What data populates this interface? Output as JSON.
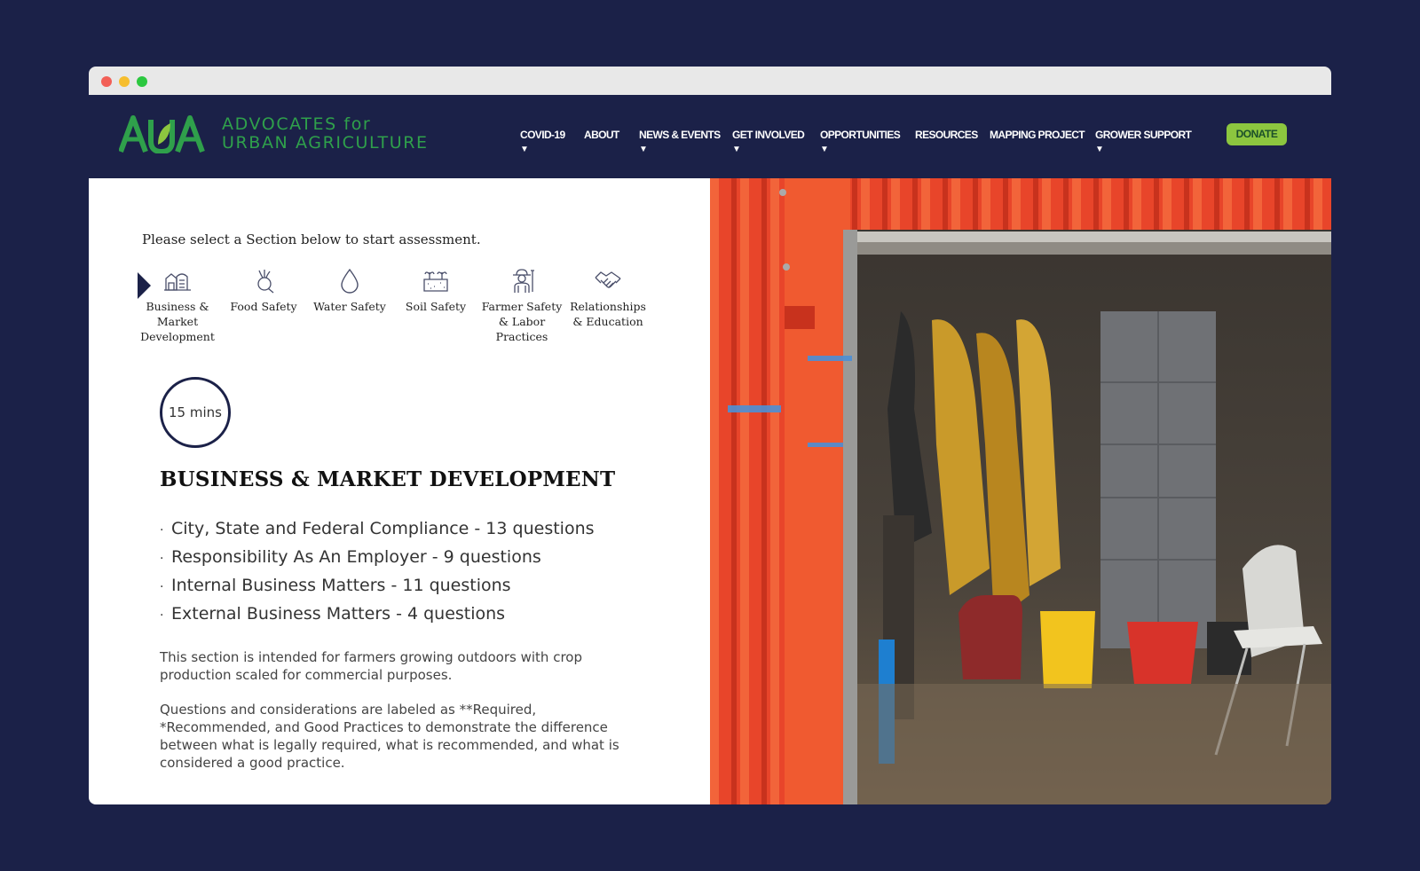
{
  "brand": {
    "name_line1": "ADVOCATES for",
    "name_line2": "URBAN AGRICULTURE",
    "accent_color": "#2fa04b",
    "header_bg": "#1b2148"
  },
  "nav": {
    "items": [
      {
        "label": "COVID-19",
        "has_dropdown": true
      },
      {
        "label": "ABOUT",
        "has_dropdown": false
      },
      {
        "label": "NEWS & EVENTS",
        "has_dropdown": true
      },
      {
        "label": "GET INVOLVED",
        "has_dropdown": true
      },
      {
        "label": "OPPORTUNITIES",
        "has_dropdown": true
      },
      {
        "label": "RESOURCES",
        "has_dropdown": false
      },
      {
        "label": "MAPPING PROJECT",
        "has_dropdown": false
      },
      {
        "label": "GROWER SUPPORT",
        "has_dropdown": true
      }
    ],
    "caret": "▼",
    "donate_label": "DONATE"
  },
  "assessment": {
    "intro": "Please select a Section below to start assessment.",
    "sections": [
      {
        "label": "Business & Market Development",
        "icon": "barn-icon"
      },
      {
        "label": "Food Safety",
        "icon": "beet-icon"
      },
      {
        "label": "Water Safety",
        "icon": "water-drop-icon"
      },
      {
        "label": "Soil Safety",
        "icon": "soil-sprout-icon"
      },
      {
        "label": "Farmer Safety & Labor Practices",
        "icon": "farmer-icon"
      },
      {
        "label": "Relationships & Education",
        "icon": "handshake-icon"
      }
    ],
    "selected_section": "Business & Market Development",
    "timer": "15 mins",
    "title": "BUSINESS & MARKET DEVELOPMENT",
    "questions": [
      "City, State and Federal Compliance - 13 questions",
      "Responsibility As An Employer - 9 questions",
      "Internal Business Matters - 11 questions",
      "External Business Matters - 4 questions"
    ],
    "bullet": "·",
    "description1": "This section is intended for farmers growing outdoors with crop production scaled for commercial purposes.",
    "description2": "Questions and considerations are labeled as **Required, *Recommended, and Good Practices to demonstrate the difference between what is legally required, what is recommended, and what is considered a good practice."
  },
  "photo": {
    "subject": "red shipping container with open door showing lockers, rain gear and buckets"
  }
}
